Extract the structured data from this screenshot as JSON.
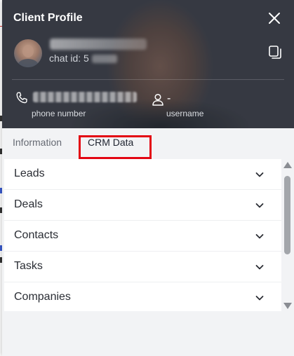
{
  "panel": {
    "title": "Client Profile",
    "chat_id_label": "chat id: 5",
    "fields": {
      "phone_label": "phone number",
      "username_value": "-",
      "username_label": "username"
    }
  },
  "tabs": [
    {
      "label": "Information",
      "active": false
    },
    {
      "label": "CRM Data",
      "active": true
    }
  ],
  "crm_sections": [
    {
      "label": "Leads"
    },
    {
      "label": "Deals"
    },
    {
      "label": "Contacts"
    },
    {
      "label": "Tasks"
    },
    {
      "label": "Companies"
    }
  ],
  "colors": {
    "tab_underline": "#3f63d6",
    "highlight_box": "#e30613"
  },
  "icons": [
    "close-icon",
    "copy-icon",
    "phone-icon",
    "user-icon",
    "chevron-down-icon"
  ]
}
